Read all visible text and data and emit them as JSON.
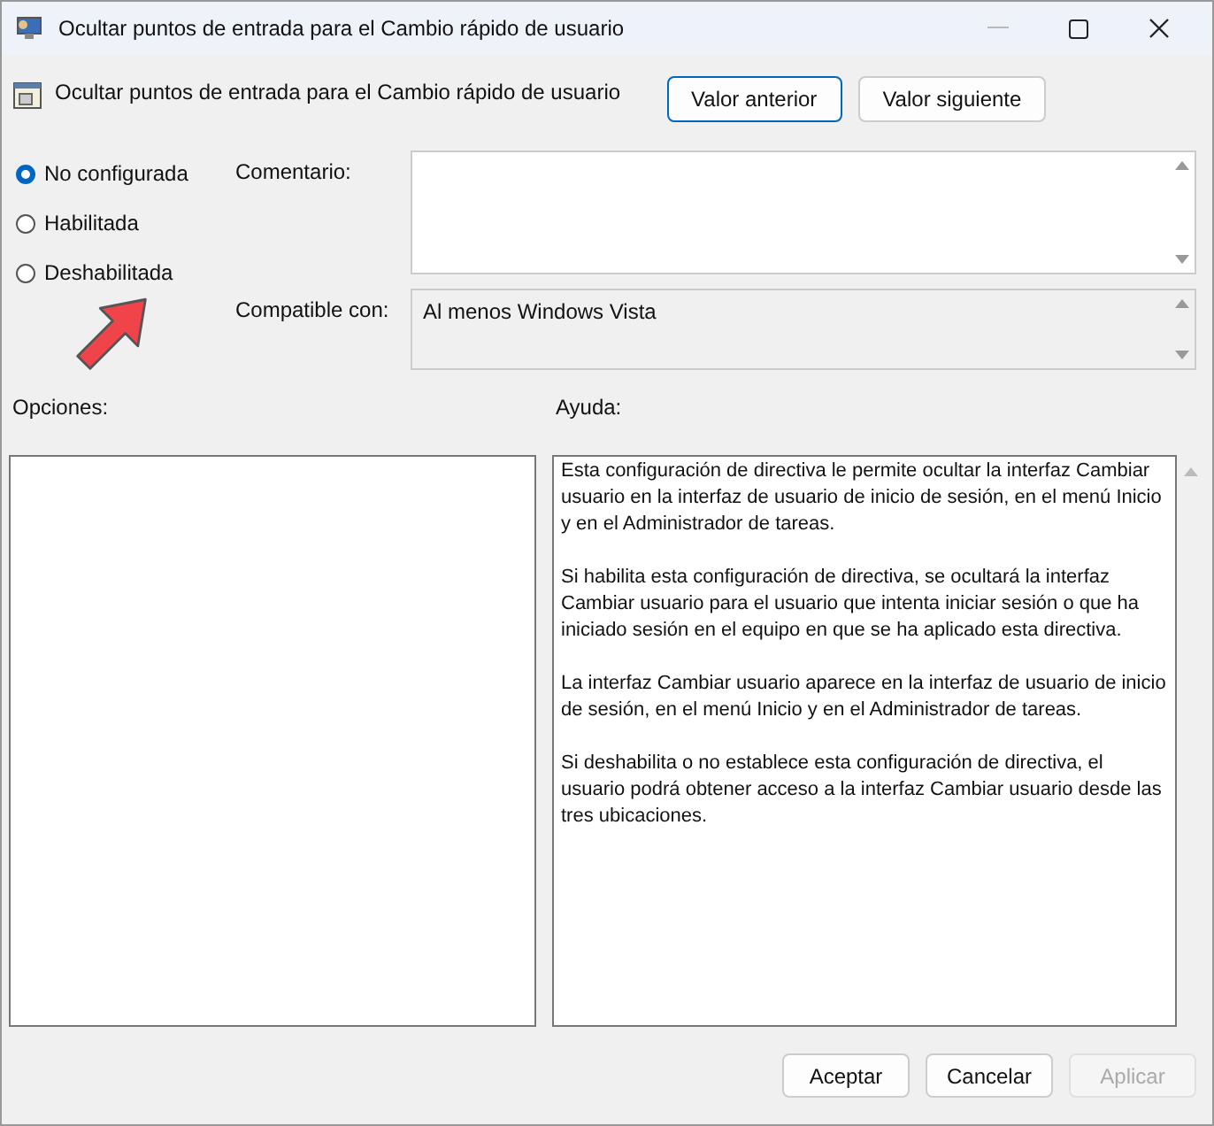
{
  "window": {
    "title": "Ocultar puntos de entrada para el Cambio rápido de usuario"
  },
  "header": {
    "title": "Ocultar puntos de entrada para el Cambio rápido de usuario",
    "buttons": [
      {
        "label": "Valor anterior",
        "focused": true
      },
      {
        "label": "Valor siguiente",
        "focused": false
      }
    ]
  },
  "state_options": [
    {
      "label": "No configurada",
      "selected": true
    },
    {
      "label": "Habilitada",
      "selected": false
    },
    {
      "label": "Deshabilitada",
      "selected": false
    }
  ],
  "comment": {
    "label": "Comentario:"
  },
  "supported": {
    "label": "Compatible con:",
    "value": "Al menos Windows Vista"
  },
  "options": {
    "label": "Opciones:"
  },
  "help": {
    "label": "Ayuda:",
    "paragraphs": [
      "Esta configuración de directiva le permite ocultar la interfaz Cambiar usuario en la interfaz de usuario de inicio de sesión, en el menú Inicio y en el Administrador de tareas.",
      "Si habilita esta configuración de directiva, se ocultará la interfaz Cambiar usuario para el usuario que intenta iniciar sesión o que ha iniciado sesión en el equipo en que se ha aplicado esta directiva.",
      "La interfaz Cambiar usuario aparece en la interfaz de usuario de inicio de sesión, en el menú Inicio y en el Administrador de tareas.",
      "Si deshabilita o no establece esta configuración de directiva, el usuario podrá obtener acceso a la interfaz Cambiar usuario desde las tres ubicaciones."
    ]
  },
  "footer_buttons": [
    {
      "label": "Aceptar",
      "disabled": false
    },
    {
      "label": "Cancelar",
      "disabled": false
    },
    {
      "label": "Aplicar",
      "disabled": true
    }
  ]
}
